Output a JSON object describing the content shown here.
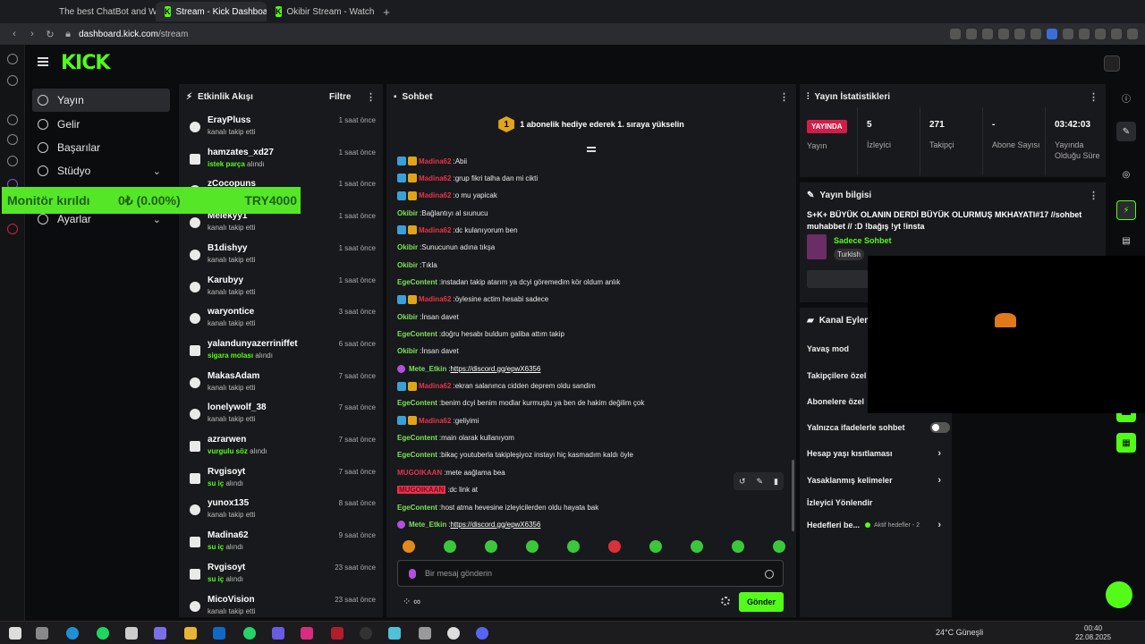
{
  "browser": {
    "tabs": [
      {
        "title": "The best ChatBot and Wi",
        "active": false
      },
      {
        "title": "Stream - Kick Dashboard",
        "active": true
      },
      {
        "title": "Okibir Stream - Watch Liv",
        "active": false
      }
    ],
    "url_domain": "dashboard.kick.com",
    "url_path": "/stream"
  },
  "app": {
    "logo": "KICK"
  },
  "nav": {
    "items": [
      {
        "label": "Yayın",
        "active": true
      },
      {
        "label": "Gelir"
      },
      {
        "label": "Başarılar"
      },
      {
        "label": "Stüdyo"
      },
      {
        "label": "Ayarlar"
      }
    ]
  },
  "overlay_monitor": {
    "label": "Monitör kırıldı",
    "amount": "0₺ (0.00%)",
    "goal": "TRY4000"
  },
  "activity": {
    "title": "Etkinlik Akışı",
    "filter_label": "Filtre",
    "items": [
      {
        "user": "ErayPluss",
        "desc": "kanalı takip etti",
        "highlight": "",
        "desc_suffix": "",
        "time": "1 saat önce",
        "type": "follow"
      },
      {
        "user": "hamzates_xd27",
        "desc": "",
        "highlight": "istek parça",
        "desc_suffix": " alındı",
        "time": "1 saat önce",
        "type": "gift"
      },
      {
        "user": "zCocopuns",
        "desc": "",
        "highlight": "",
        "desc_suffix": "",
        "time": "1 saat önce",
        "type": "follow"
      },
      {
        "user": "Melekyy1",
        "desc": "kanalı takip etti",
        "highlight": "",
        "desc_suffix": "",
        "time": "1 saat önce",
        "type": "follow"
      },
      {
        "user": "B1dishyy",
        "desc": "kanalı takip etti",
        "highlight": "",
        "desc_suffix": "",
        "time": "1 saat önce",
        "type": "follow"
      },
      {
        "user": "Karubyy",
        "desc": "kanalı takip etti",
        "highlight": "",
        "desc_suffix": "",
        "time": "1 saat önce",
        "type": "follow"
      },
      {
        "user": "waryontice",
        "desc": "kanalı takip etti",
        "highlight": "",
        "desc_suffix": "",
        "time": "3 saat önce",
        "type": "follow"
      },
      {
        "user": "yalandunyazerriniffet",
        "desc": "",
        "highlight": "sigara molası",
        "desc_suffix": " alındı",
        "time": "6 saat önce",
        "type": "gift"
      },
      {
        "user": "MakasAdam",
        "desc": "kanalı takip etti",
        "highlight": "",
        "desc_suffix": "",
        "time": "7 saat önce",
        "type": "follow"
      },
      {
        "user": "lonelywolf_38",
        "desc": "kanalı takip etti",
        "highlight": "",
        "desc_suffix": "",
        "time": "7 saat önce",
        "type": "follow"
      },
      {
        "user": "azrarwen",
        "desc": "",
        "highlight": "vurgulu söz",
        "desc_suffix": " alındı",
        "time": "7 saat önce",
        "type": "gift"
      },
      {
        "user": "Rvgisoyt",
        "desc": "",
        "highlight": "su iç",
        "desc_suffix": " alındı",
        "time": "7 saat önce",
        "type": "gift"
      },
      {
        "user": "yunox135",
        "desc": "kanalı takip etti",
        "highlight": "",
        "desc_suffix": "",
        "time": "8 saat önce",
        "type": "follow"
      },
      {
        "user": "Madina62",
        "desc": "",
        "highlight": "su iç",
        "desc_suffix": " alındı",
        "time": "9 saat önce",
        "type": "gift"
      },
      {
        "user": "Rvgisoyt",
        "desc": "",
        "highlight": "su iç",
        "desc_suffix": " alındı",
        "time": "23 saat önce",
        "type": "gift"
      },
      {
        "user": "MicoVision",
        "desc": "kanalı takip etti",
        "highlight": "",
        "desc_suffix": "",
        "time": "23 saat önce",
        "type": "follow"
      }
    ]
  },
  "chat": {
    "title": "Sohbet",
    "pinned_number": "1",
    "pinned_text": "1 abonelik hediye ederek 1. sıraya yükselin",
    "messages": [
      {
        "badges": true,
        "user": "Madina62",
        "color": "#e6334d",
        "text": "Abii",
        "link": false
      },
      {
        "badges": true,
        "user": "Madina62",
        "color": "#e6334d",
        "text": "grup fikri talha dan mi cikti",
        "link": false
      },
      {
        "badges": true,
        "user": "Madina62",
        "color": "#e6334d",
        "text": "o mu yapicak",
        "link": false
      },
      {
        "badges": false,
        "user": "Okibir",
        "color": "#7ee05c",
        "text": "Bağlantıyı al sıunucu",
        "link": false
      },
      {
        "badges": true,
        "user": "Madina62",
        "color": "#e6334d",
        "text": "dc kulanıyorum ben",
        "link": false
      },
      {
        "badges": false,
        "user": "Okibir",
        "color": "#7ee05c",
        "text": "Sunucunun adına tıkşa",
        "link": false
      },
      {
        "badges": false,
        "user": "Okibir",
        "color": "#7ee05c",
        "text": "Tıkla",
        "link": false
      },
      {
        "badges": false,
        "user": "EgeContent",
        "color": "#7ee05c",
        "text": "instadan takip atarım ya dcyi göremedim kör oldum anlık",
        "link": false
      },
      {
        "badges": true,
        "user": "Madina62",
        "color": "#e6334d",
        "text": "öylesine actim hesabi sadece",
        "link": false
      },
      {
        "badges": false,
        "user": "Okibir",
        "color": "#7ee05c",
        "text": "İnsan davet",
        "link": false
      },
      {
        "badges": false,
        "user": "EgeContent",
        "color": "#7ee05c",
        "text": "doğru hesabı buldum galiba attım takip",
        "link": false
      },
      {
        "badges": false,
        "user": "Okibir",
        "color": "#7ee05c",
        "text": "İnsan davet",
        "link": false
      },
      {
        "badges": false,
        "mod": true,
        "user": "Mete_Etkin",
        "color": "#7ee05c",
        "text": "https://discord.gg/epwX6356",
        "link": true
      },
      {
        "badges": true,
        "user": "Madina62",
        "color": "#e6334d",
        "text": "ekran salanınca cidden deprem oldu sandim",
        "link": false
      },
      {
        "badges": false,
        "user": "EgeContent",
        "color": "#7ee05c",
        "text": "benim dcyi benim modlar kurmuştu ya ben de hakim değilim çok",
        "link": false
      },
      {
        "badges": true,
        "user": "Madina62",
        "color": "#e6334d",
        "text": "geliyimi",
        "link": false
      },
      {
        "badges": false,
        "user": "EgeContent",
        "color": "#7ee05c",
        "text": "main olarak kullanıyom",
        "link": false
      },
      {
        "badges": false,
        "user": "EgeContent",
        "color": "#7ee05c",
        "text": "bikaç youtuberla takipleşiyoz instayı hiç kasmadım kaldı öyle",
        "link": false
      },
      {
        "badges": false,
        "user": "MUGOIKAAN",
        "color": "#e6334d",
        "text": "mete aağlama bea",
        "link": false
      },
      {
        "badges": false,
        "user": "MUGOIKAAN",
        "color": "#e6334d",
        "text": "dc link at",
        "link": false,
        "selected": true
      },
      {
        "badges": false,
        "user": "EgeContent",
        "color": "#7ee05c",
        "text": "host atma hevesine izleyicilerden oldu hayata bak",
        "link": false
      },
      {
        "badges": false,
        "mod": true,
        "user": "Mete_Etkin",
        "color": "#7ee05c",
        "text": "https://discord.gg/epwX6356",
        "link": true
      }
    ],
    "input_placeholder": "Bir mesaj gönderin",
    "send_label": "Gönder"
  },
  "stats": {
    "title": "Yayın İstatistikleri",
    "live_badge": "YAYINDA",
    "live_label": "Yayın",
    "items": [
      {
        "value": "5",
        "label": "İzleyici"
      },
      {
        "value": "271",
        "label": "Takipçi"
      },
      {
        "value": "-",
        "label": "Abone Sayısı"
      },
      {
        "value": "03:42:03",
        "label": "Yayında Olduğu Süre"
      }
    ]
  },
  "stream_info": {
    "title": "Yayın bilgisi",
    "stream_title": "S+K+ BÜYÜK OLANIN DERDİ BÜYÜK OLURMUŞ MKHAYATI#17 //sohbet muhabbet // :D !bağış !yt !insta",
    "category": "Sadece Sohbet",
    "language": "Turkish"
  },
  "channel_actions": {
    "title": "Kanal Eylem",
    "items": [
      {
        "label": "Yavaş mod",
        "arrow": false
      },
      {
        "label": "Takipçilere özel",
        "arrow": false
      },
      {
        "label": "Abonelere özel",
        "arrow": false
      },
      {
        "label": "Yalnızca ifadelerle sohbet",
        "arrow": false,
        "toggle": true
      },
      {
        "label": "Hesap yaşı kısıtlaması",
        "arrow": true
      },
      {
        "label": "Yasaklanmış kelimeler",
        "arrow": true
      },
      {
        "label": "İzleyici Yönlendir",
        "arrow": false
      },
      {
        "label": "Hedefleri be...",
        "arrow": true,
        "sub": "Aktif hedefler - 2"
      }
    ]
  },
  "taskbar": {
    "weather": "24°C Güneşli",
    "time": "00:40",
    "date": "22.08.2025"
  }
}
